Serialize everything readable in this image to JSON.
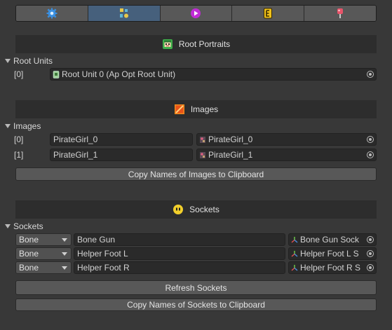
{
  "toolbar": {
    "tabs": [
      {
        "icon": "gear-icon",
        "active": false
      },
      {
        "icon": "bones-icon",
        "active": true
      },
      {
        "icon": "play-icon",
        "active": false
      },
      {
        "icon": "event-icon",
        "active": false
      },
      {
        "icon": "pin-icon",
        "active": false
      }
    ]
  },
  "root_portraits": {
    "header": "Root Portraits",
    "foldout_label": "Root Units",
    "items": [
      {
        "index": "[0]",
        "value": "Root Unit 0 (Ap Opt Root Unit)"
      }
    ]
  },
  "images": {
    "header": "Images",
    "foldout_label": "Images",
    "items": [
      {
        "index": "[0]",
        "name": "PirateGirl_0",
        "sprite": "PirateGirl_0"
      },
      {
        "index": "[1]",
        "name": "PirateGirl_1",
        "sprite": "PirateGirl_1"
      }
    ],
    "copy_button": "Copy Names of Images to Clipboard"
  },
  "sockets": {
    "header": "Sockets",
    "foldout_label": "Sockets",
    "items": [
      {
        "type": "Bone",
        "name": "Bone Gun",
        "ref": "Bone Gun Sock"
      },
      {
        "type": "Bone",
        "name": "Helper Foot L",
        "ref": "Helper Foot L S"
      },
      {
        "type": "Bone",
        "name": "Helper Foot R",
        "ref": "Helper Foot R S"
      }
    ],
    "refresh_button": "Refresh Sockets",
    "copy_button": "Copy Names of Sockets to Clipboard"
  },
  "colors": {
    "background": "#383838",
    "section_header": "#2d2d2d",
    "active_tab": "#46607c",
    "field": "#2a2a2a"
  }
}
